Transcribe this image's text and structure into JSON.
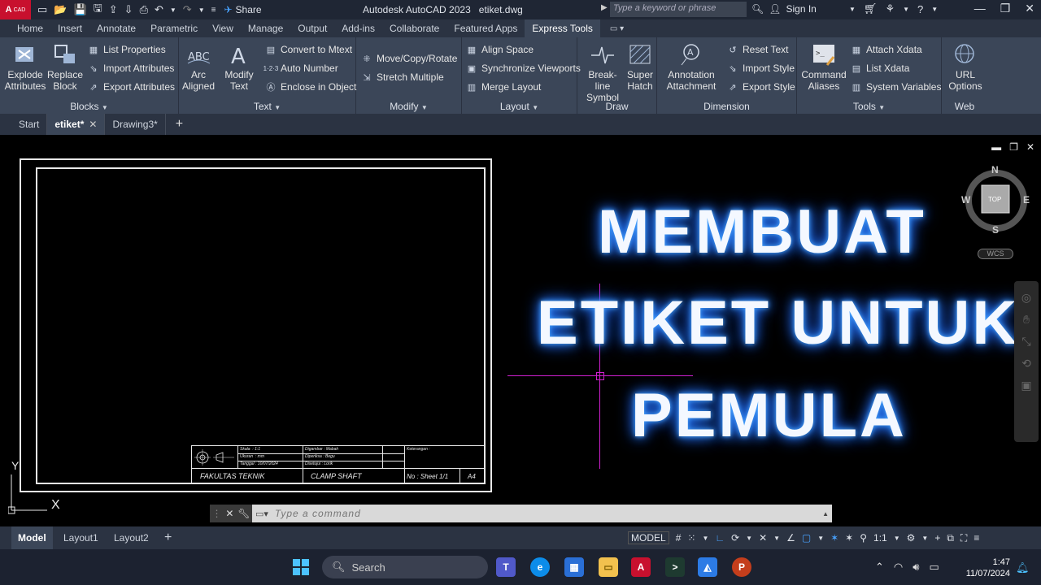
{
  "titlebar": {
    "logo": "A",
    "logo_sub": "CAD",
    "share": "Share",
    "app_title": "Autodesk AutoCAD 2023",
    "file_title": "etiket.dwg",
    "search_placeholder": "Type a keyword or phrase",
    "sign_in": "Sign In"
  },
  "ribbon_tabs": [
    "Home",
    "Insert",
    "Annotate",
    "Parametric",
    "View",
    "Manage",
    "Output",
    "Add-ins",
    "Collaborate",
    "Featured Apps",
    "Express Tools"
  ],
  "ribbon_active_tab": "Express Tools",
  "ribbon": {
    "blocks": {
      "label": "Blocks",
      "explode": "Explode Attributes",
      "replace": "Replace Block",
      "list_properties": "List Properties",
      "import_attributes": "Import Attributes",
      "export_attributes": "Export Attributes"
    },
    "text": {
      "label": "Text",
      "arc_aligned": "Arc Aligned",
      "modify_text": "Modify Text",
      "convert_mtext": "Convert to Mtext",
      "auto_number": "Auto Number",
      "enclose": "Enclose in Object"
    },
    "modify": {
      "label": "Modify",
      "move_copy_rotate": "Move/Copy/Rotate",
      "stretch_multiple": "Stretch Multiple"
    },
    "layout": {
      "label": "Layout",
      "align_space": "Align Space",
      "sync_viewports": "Synchronize Viewports",
      "merge_layout": "Merge Layout"
    },
    "draw": {
      "label": "Draw",
      "break_line": "Break-line Symbol",
      "super_hatch": "Super Hatch"
    },
    "dimension": {
      "label": "Dimension",
      "annotation": "Annotation Attachment",
      "reset_text": "Reset Text",
      "import_style": "Import Style",
      "export_style": "Export Style"
    },
    "tools": {
      "label": "Tools",
      "command_aliases": "Command Aliases",
      "attach_xdata": "Attach Xdata",
      "list_xdata": "List Xdata",
      "system_variables": "System Variables"
    },
    "web": {
      "label": "Web",
      "url_options": "URL Options"
    }
  },
  "file_tabs": {
    "start": "Start",
    "active": "etiket*",
    "other": "Drawing3*"
  },
  "title_block": {
    "skala_label": "Skala",
    "skala_value": ": 1:1",
    "ukuran_label": "Ukuran",
    "ukuran_value": ": mm",
    "tanggal_label": "Tanggal",
    "tanggal_value": ": 10/07/2024",
    "digambar": "Digambar : Mabah",
    "diperiksa": "Diperiksa : Begu",
    "disetujui": "Disetujui : Lorik",
    "keterangan": "Keterangan :",
    "fakultas": "FAKULTAS TEKNIK",
    "part": "CLAMP SHAFT",
    "sheet": "No : Sheet 1/1",
    "size": "A4"
  },
  "ucs": {
    "y": "Y",
    "x": "X"
  },
  "overlay": {
    "line1": "MEMBUAT",
    "line2": "ETIKET UNTUK",
    "line3": "PEMULA"
  },
  "viewcube": {
    "n": "N",
    "s": "S",
    "e": "E",
    "w": "W",
    "top": "TOP",
    "wcs": "WCS"
  },
  "command": {
    "placeholder": "Type a command"
  },
  "status": {
    "model_tab": "Model",
    "layout1": "Layout1",
    "layout2": "Layout2",
    "model_btn": "MODEL",
    "scale": "1:1"
  },
  "taskbar": {
    "search": "Search",
    "time": "1:47",
    "date": "11/07/2024"
  },
  "colors": {
    "accent": "#48a2ff",
    "crosshair": "#d020d0",
    "logo": "#c8102e"
  }
}
